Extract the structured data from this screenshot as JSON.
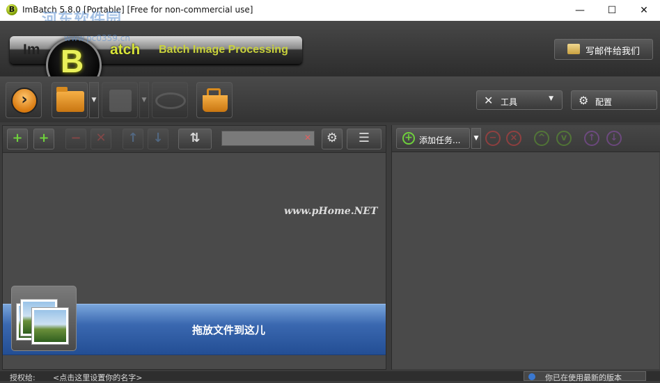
{
  "window": {
    "title": "ImBatch 5.8.0 [Portable] [Free for non-commercial use]",
    "app_icon_letter": "B",
    "min_glyph": "—",
    "max_glyph": "☐",
    "close_glyph": "✕"
  },
  "watermark": {
    "top": "河东软件园",
    "sub": "www.pc0359.cn",
    "center": "www.pHome.NET"
  },
  "brand": {
    "logo_left": "Im",
    "logo_ball": "B",
    "logo_right": "atch",
    "tagline": "Batch Image Processing",
    "mail_button": "写邮件给我们"
  },
  "toolbar": {
    "tools_label": "工具",
    "settings_label": "配置",
    "caret": "▼"
  },
  "left_panel": {
    "search_placeholder": "",
    "drop_label": "拖放文件到这儿"
  },
  "right_panel": {
    "add_task_label": "添加任务...",
    "caret": "▼"
  },
  "status_bar": {
    "licensed_label": "授权给:",
    "licensed_value": "<点击这里设置你的名字>",
    "version_status": "你已在使用最新的版本"
  },
  "colors": {
    "accent_orange": "#f0a030",
    "banner_blue": "#3a68b0",
    "logo_yellow": "#d8e43a"
  },
  "icons": [
    "app-icon",
    "play-icon",
    "folder-icon",
    "disk-icon",
    "eye-icon",
    "basket-icon",
    "wrench-icon",
    "gear-icon",
    "mail-icon",
    "add-icon",
    "remove-icon",
    "move-icon",
    "settings-icon",
    "view-icon"
  ]
}
